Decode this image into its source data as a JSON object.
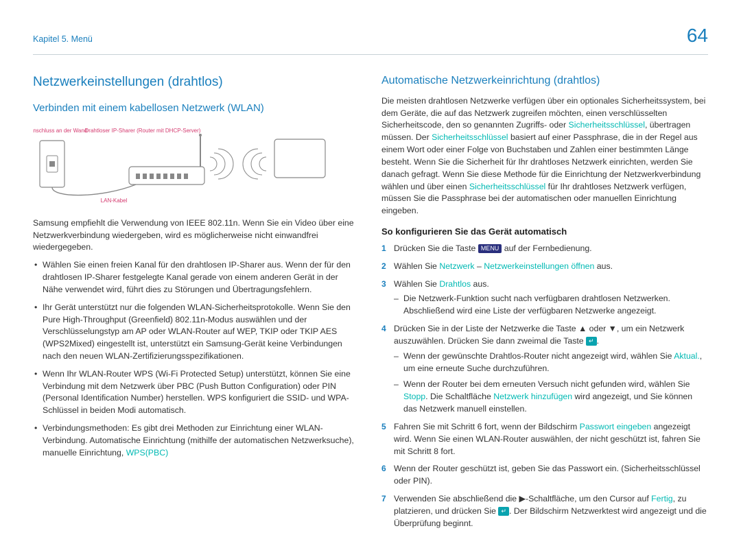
{
  "header": {
    "chapter": "Kapitel 5. Menü",
    "page": "64"
  },
  "left": {
    "title": "Netzwerkeinstellungen (drahtlos)",
    "subtitle": "Verbinden mit einem kabellosen Netzwerk (WLAN)",
    "diagram": {
      "lan_wall": "LAN-Anschluss an der Wand",
      "ip_sharer": "Drahtloser IP-Sharer (Router mit DHCP-Server)",
      "lan_cable": "LAN-Kabel"
    },
    "intro": "Samsung empfiehlt die Verwendung von IEEE 802.11n. Wenn Sie ein Video über eine Netzwerkverbindung wiedergeben, wird es möglicherweise nicht einwandfrei wiedergegeben.",
    "bullets": [
      "Wählen Sie einen freien Kanal für den drahtlosen IP-Sharer aus. Wenn der für den drahtlosen IP-Sharer festgelegte Kanal gerade von einem anderen Gerät in der Nähe verwendet wird, führt dies zu Störungen und Übertragungsfehlern.",
      "Ihr Gerät unterstützt nur die folgenden WLAN-Sicherheitsprotokolle.\nWenn Sie den Pure High-Throughput (Greenfield) 802.11n-Modus auswählen und der Verschlüsselungstyp am AP oder WLAN-Router auf WEP, TKIP oder TKIP AES (WPS2Mixed) eingestellt ist, unterstützt ein Samsung-Gerät keine Verbindungen nach den neuen WLAN-Zertifizierungsspezifikationen.",
      "Wenn Ihr WLAN-Router WPS (Wi-Fi Protected Setup) unterstützt, können Sie eine Verbindung mit dem Netzwerk über PBC (Push Button Configuration) oder PIN (Personal Identification Number) herstellen. WPS konfiguriert die SSID- und WPA-Schlüssel in beiden Modi automatisch."
    ],
    "bullet4_pre": "Verbindungsmethoden: Es gibt drei Methoden zur Einrichtung einer WLAN-Verbindung.\nAutomatische Einrichtung (mithilfe der automatischen Netzwerksuche), manuelle Einrichtung, ",
    "bullet4_accent": "WPS(PBC)"
  },
  "right": {
    "title": "Automatische Netzwerkeinrichtung (drahtlos)",
    "para_pre": "Die meisten drahtlosen Netzwerke verfügen über ein optionales Sicherheitssystem, bei dem Geräte, die auf das Netzwerk zugreifen möchten, einen verschlüsselten Sicherheitscode, den so genannten Zugriffs- oder ",
    "term_sec_key": "Sicherheitsschlüssel",
    "para_mid1": ", übertragen müssen. Der ",
    "para_mid2": " basiert auf einer Passphrase, die in der Regel aus einem Wort oder einer Folge von Buchstaben und Zahlen einer bestimmten Länge besteht. Wenn Sie die Sicherheit für Ihr drahtloses Netzwerk einrichten, werden Sie danach gefragt. Wenn Sie diese Methode für die Einrichtung der Netzwerkverbindung wählen und über einen ",
    "para_post": " für Ihr drahtloses Netzwerk verfügen, müssen Sie die Passphrase bei der automatischen oder manuellen Einrichtung eingeben.",
    "howto_title": "So konfigurieren Sie das Gerät automatisch",
    "s1_pre": "Drücken Sie die Taste ",
    "s1_kbd": "MENU",
    "s1_post": " auf der Fernbedienung.",
    "s2_pre": "Wählen Sie ",
    "s2_a": "Netzwerk",
    "s2_sep": " – ",
    "s2_b": "Netzwerkeinstellungen öffnen",
    "s2_post": " aus.",
    "s3_pre": "Wählen Sie ",
    "s3_a": "Drahtlos",
    "s3_post": " aus.",
    "s3_dash": "Die Netzwerk-Funktion sucht nach verfügbaren drahtlosen Netzwerken. Abschließend wird eine Liste der verfügbaren Netzwerke angezeigt.",
    "s4_pre": "Drücken Sie in der Liste der Netzwerke die Taste ▲ oder ▼, um ein Netzwerk auszuwählen. Drücken Sie dann zweimal die Taste ",
    "s4_kbd": "↵",
    "s4_post": ".",
    "s4_dash1_pre": "Wenn der gewünschte Drahtlos-Router nicht angezeigt wird, wählen Sie ",
    "s4_dash1_a": "Aktual.",
    "s4_dash1_post": ", um eine erneute Suche durchzuführen.",
    "s4_dash2_pre": "Wenn der Router bei dem erneuten Versuch nicht gefunden wird, wählen Sie ",
    "s4_dash2_a": "Stopp",
    "s4_dash2_post": ". Die Schaltfläche ",
    "s4_dash2_b": "Netzwerk hinzufügen",
    "s4_dash2_end": " wird angezeigt, und Sie können das Netzwerk manuell einstellen.",
    "s5_pre": "Fahren Sie mit Schritt 6 fort, wenn der Bildschirm ",
    "s5_a": "Passwort eingeben",
    "s5_post": " angezeigt wird. Wenn Sie einen WLAN-Router auswählen, der nicht geschützt ist, fahren Sie mit Schritt 8 fort.",
    "s6": "Wenn der Router geschützt ist, geben Sie das Passwort ein. (Sicherheitsschlüssel oder PIN).",
    "s7_pre": "Verwenden Sie abschließend die ▶-Schaltfläche, um den Cursor auf ",
    "s7_a": "Fertig",
    "s7_mid": ", zu platzieren, und drücken Sie ",
    "s7_kbd": "↵",
    "s7_post": ". Der Bildschirm Netzwerktest wird angezeigt und die Überprüfung beginnt."
  }
}
